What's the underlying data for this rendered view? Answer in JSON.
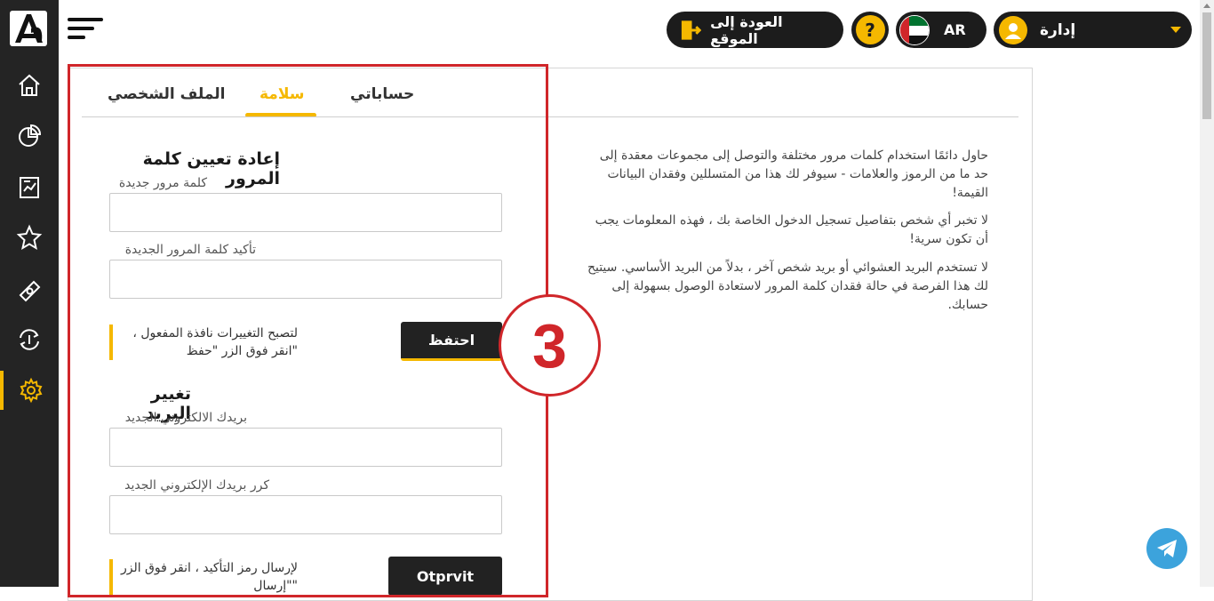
{
  "topbar": {
    "back_label": "العودة إلى الموقع",
    "help_label": "?",
    "lang_label": "AR",
    "user_label": "إدارة"
  },
  "tabs": [
    {
      "label": "الملف الشخصي",
      "active": false
    },
    {
      "label": "سلامة",
      "active": true
    },
    {
      "label": "حساباتي",
      "active": false
    }
  ],
  "password_section": {
    "title": "إعادة تعيين كلمة المرور",
    "new_label": "كلمة مرور جديدة",
    "new_value": "",
    "confirm_label": "تأكيد كلمة المرور الجديدة",
    "confirm_value": "",
    "note_line1": "لتصبح التغييرات نافذة المفعول ،",
    "note_line2": "\"انقر فوق الزر \"حفظ",
    "save_label": "احتفظ"
  },
  "email_section": {
    "title": "تغيير البريد",
    "new_label": "بريدك الالكتروني الجديد",
    "new_value": "",
    "repeat_label": "كرر بريدك الإلكتروني الجديد",
    "repeat_value": "",
    "note_line1": "لإرسال رمز التأكيد ، انقر فوق الزر",
    "note_line2": "\"\"إرسال",
    "send_label": "Otprvit"
  },
  "tips": [
    "حاول دائمًا استخدام كلمات مرور مختلفة والتوصل إلى مجموعات معقدة إلى حد ما من الرموز والعلامات - سيوفر لك هذا من المتسللين وفقدان البيانات القيمة!",
    "لا تخبر أي شخص بتفاصيل تسجيل الدخول الخاصة بك ، فهذه المعلومات يجب أن تكون سرية!",
    "لا تستخدم البريد العشوائي أو بريد شخص آخر ، بدلاً من البريد الأساسي. سيتيح لك هذا الفرصة في حالة فقدان كلمة المرور لاستعادة الوصول بسهولة إلى حسابك."
  ],
  "annotation": {
    "badge_number": "3"
  },
  "colors": {
    "accent": "#f5b800",
    "sidebar": "#242424",
    "annotation": "#d0262a"
  },
  "icons": {
    "sidebar": [
      "home-icon",
      "pie-chart-icon",
      "report-icon",
      "star-icon",
      "money-icon",
      "exchange-icon",
      "gear-icon"
    ],
    "topbar": [
      "exit-icon",
      "help-icon",
      "uae-flag-icon",
      "user-avatar-icon",
      "chevron-down-icon"
    ]
  }
}
